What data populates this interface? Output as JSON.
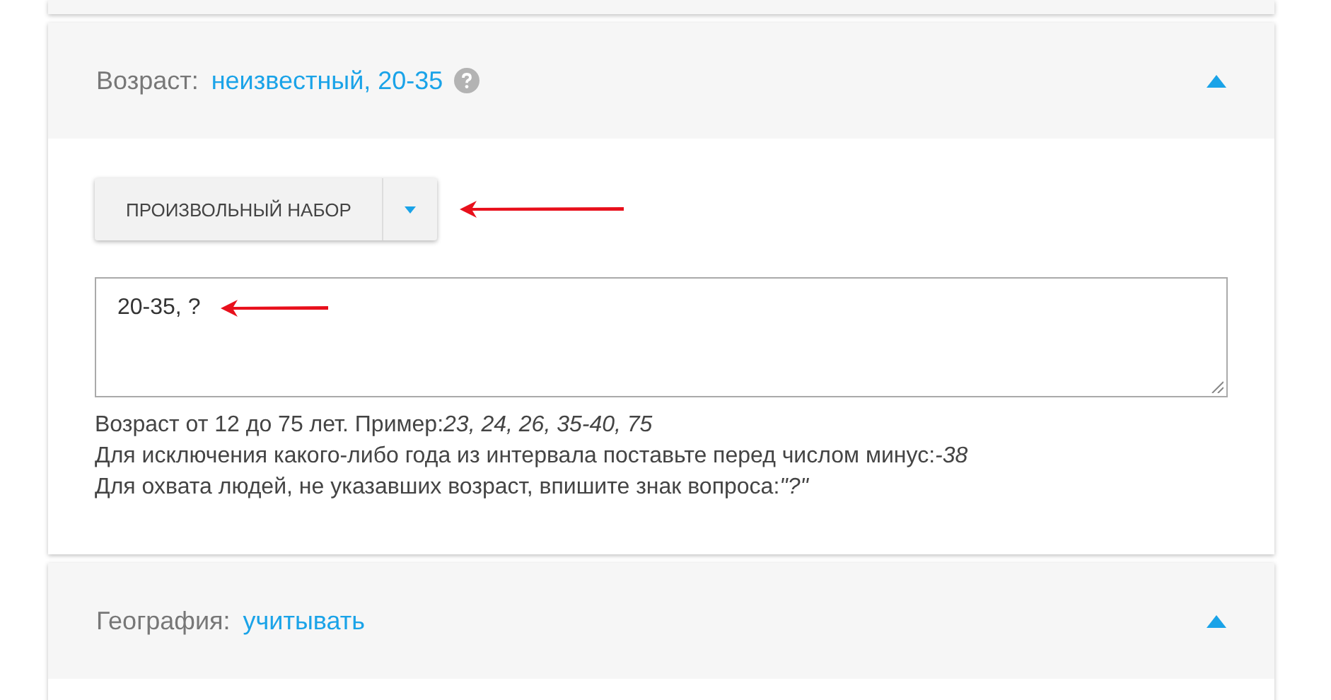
{
  "sections": [
    {
      "label": "Возраст:",
      "value": "неизвестный, 20-35",
      "help": true,
      "expanded": true,
      "preset_button": "ПРОИЗВОЛЬНЫЙ НАБОР",
      "input_value": "20-35, ?",
      "hints": [
        "Возраст от 12 до 75 лет. Пример:*23, 24, 26, 35-40, 75*",
        "Для исключения какого-либо года из интервала поставьте перед числом минус:*-38*",
        "Для охвата людей, не указавших возраст, впишите знак вопроса:*\"?\"*"
      ]
    },
    {
      "label": "География:",
      "value": "учитывать",
      "help": false,
      "expanded": true
    }
  ]
}
